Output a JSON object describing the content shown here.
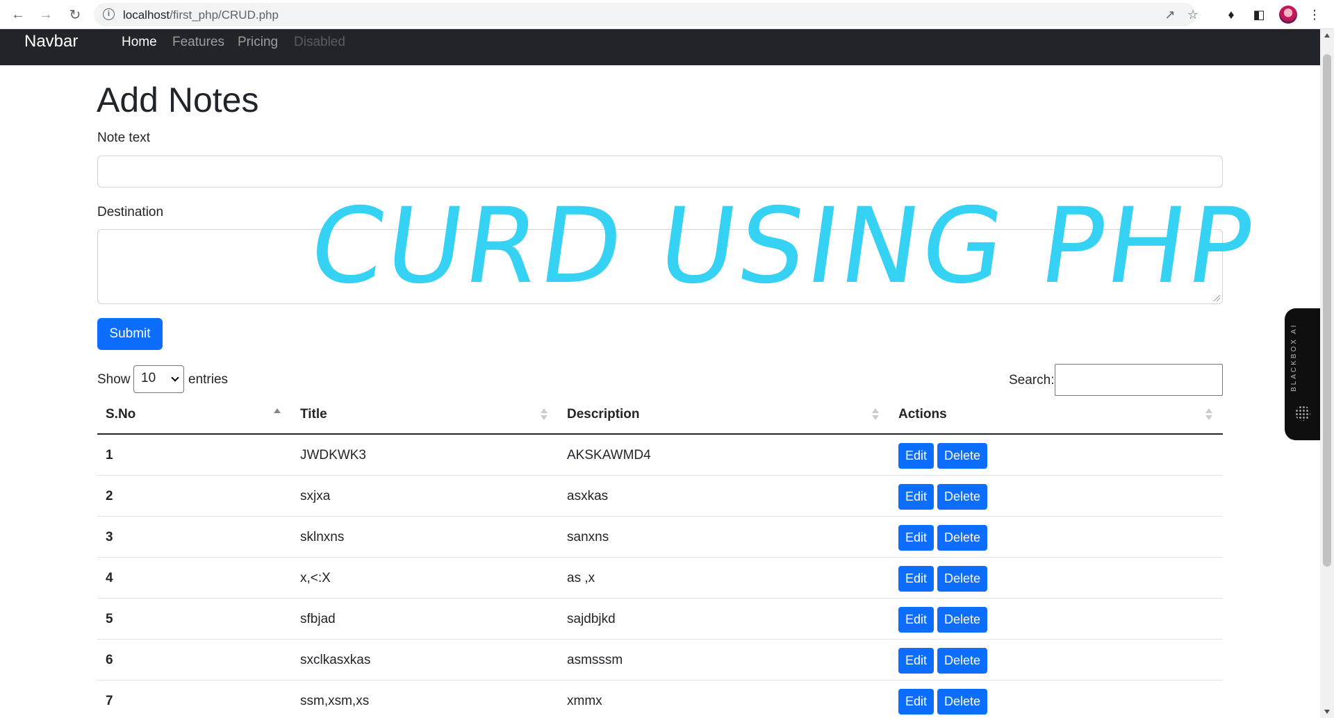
{
  "browser": {
    "url_host": "localhost",
    "url_path": "/first_php/CRUD.php"
  },
  "navbar": {
    "brand": "Navbar",
    "links": [
      {
        "label": "Home",
        "state": "active"
      },
      {
        "label": "Features",
        "state": "normal"
      },
      {
        "label": "Pricing",
        "state": "normal"
      },
      {
        "label": "Disabled",
        "state": "disabled"
      }
    ]
  },
  "form": {
    "heading": "Add Notes",
    "title_label": "Note text",
    "title_value": "",
    "description_label": "Destination",
    "description_value": "",
    "submit_label": "Submit"
  },
  "watermark": "CURD USING PHP",
  "datatable": {
    "show_label": "Show",
    "entries_value": "10",
    "entries_label": "entries",
    "search_label": "Search:",
    "search_value": "",
    "columns": [
      "S.No",
      "Title",
      "Description",
      "Actions"
    ],
    "rows": [
      {
        "sno": "1",
        "title": "JWDKWK3",
        "description": "AKSKAWMD4"
      },
      {
        "sno": "2",
        "title": "sxjxa",
        "description": "asxkas"
      },
      {
        "sno": "3",
        "title": "sklnxns",
        "description": "sanxns"
      },
      {
        "sno": "4",
        "title": "x,<:X",
        "description": "as ,x"
      },
      {
        "sno": "5",
        "title": "sfbjad",
        "description": "sajdbjkd"
      },
      {
        "sno": "6",
        "title": "sxclkasxkas",
        "description": "asmsssm"
      },
      {
        "sno": "7",
        "title": "ssm,xsm,xs",
        "description": "xmmx"
      }
    ],
    "edit_label": "Edit",
    "delete_label": "Delete"
  },
  "extension_tab": {
    "label": "BLACKBOX AI"
  },
  "colors": {
    "primary": "#0d6efd",
    "navbar_bg": "#212529",
    "watermark": "#35d2f4"
  }
}
